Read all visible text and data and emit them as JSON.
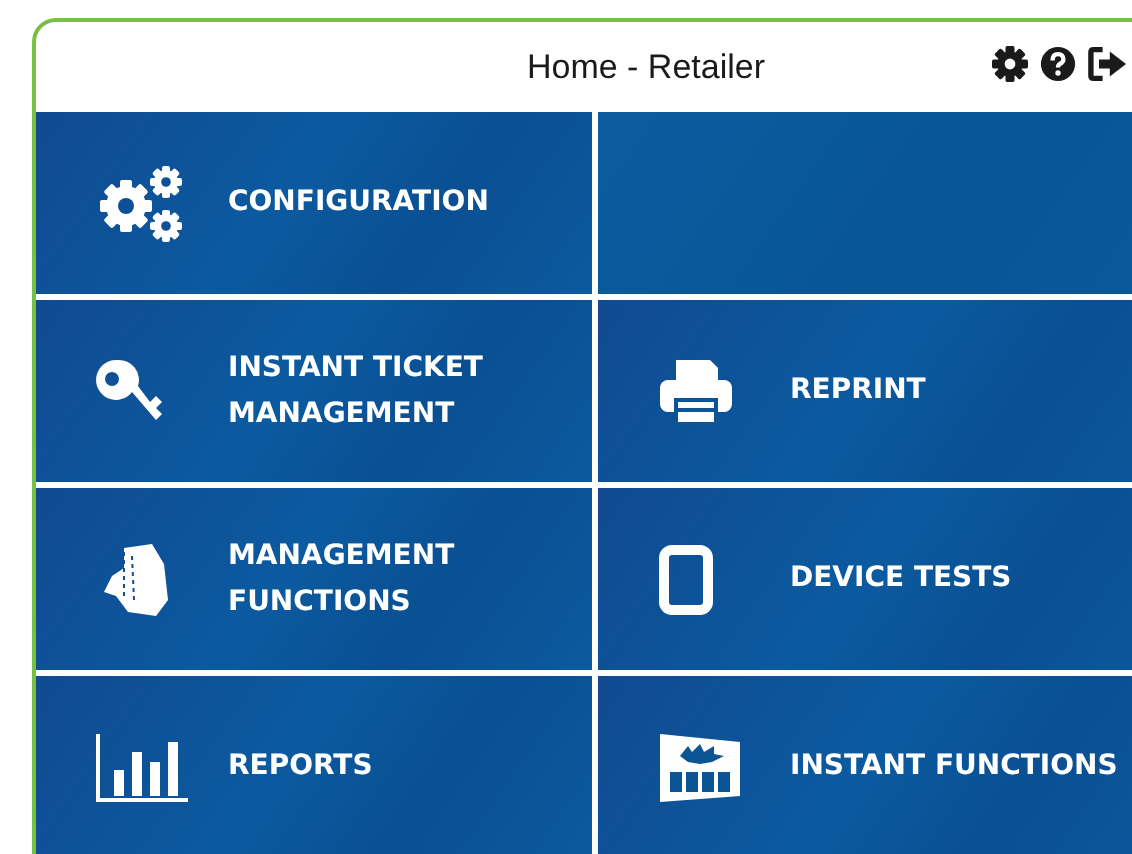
{
  "header": {
    "title": "Home - Retailer"
  },
  "tiles": [
    {
      "kind": "menu",
      "label": "CONFIGURATION"
    },
    {
      "kind": "blank"
    },
    {
      "kind": "menu",
      "label": "INSTANT TICKET\nMANAGEMENT"
    },
    {
      "kind": "menu",
      "label": "REPRINT"
    },
    {
      "kind": "menu",
      "label": "MANAGEMENT\nFUNCTIONS"
    },
    {
      "kind": "menu",
      "label": "DEVICE TESTS"
    },
    {
      "kind": "menu",
      "label": "REPORTS"
    },
    {
      "kind": "menu",
      "label": "INSTANT FUNCTIONS"
    }
  ]
}
